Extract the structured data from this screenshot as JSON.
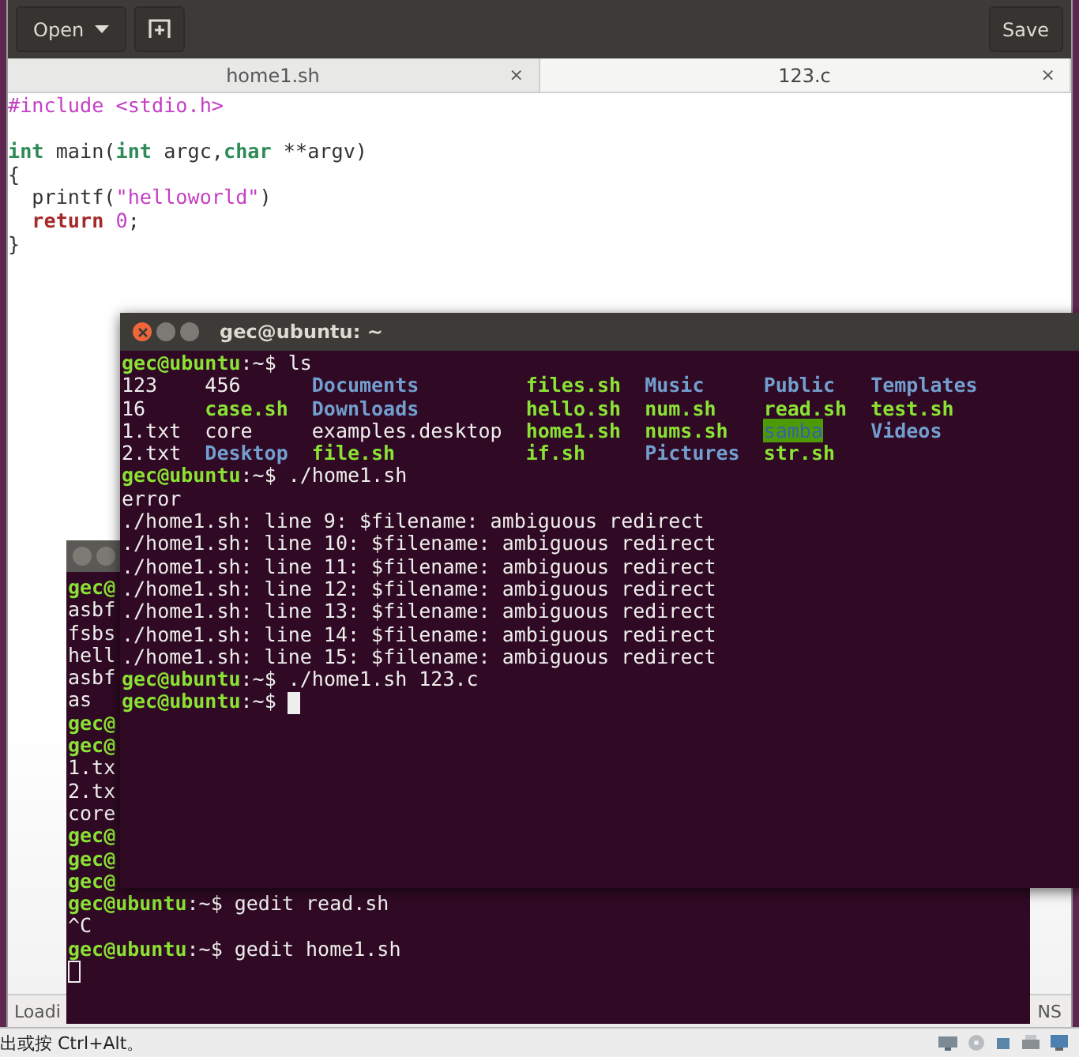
{
  "editor": {
    "toolbar": {
      "open_button": "Open",
      "save_button": "Save"
    },
    "tabs": [
      {
        "label": "home1.sh",
        "close": "×",
        "selected": false
      },
      {
        "label": "123.c",
        "close": "×",
        "selected": true
      }
    ],
    "code": [
      {
        "kind": "code",
        "segments": [
          {
            "kind": "preproc",
            "text": "#include <stdio.h>"
          }
        ]
      },
      {
        "kind": "blank"
      },
      {
        "kind": "code",
        "segments": [
          {
            "kind": "type",
            "text": "int"
          },
          {
            "kind": "plain",
            "text": " main("
          },
          {
            "kind": "type",
            "text": "int"
          },
          {
            "kind": "plain",
            "text": " argc,"
          },
          {
            "kind": "type",
            "text": "char"
          },
          {
            "kind": "plain",
            "text": " **argv)"
          }
        ]
      },
      {
        "kind": "code",
        "segments": [
          {
            "kind": "plain",
            "text": "{"
          }
        ]
      },
      {
        "kind": "code",
        "segments": [
          {
            "kind": "plain",
            "text": "  printf("
          },
          {
            "kind": "string",
            "text": "\"helloworld\""
          },
          {
            "kind": "plain",
            "text": ")"
          }
        ]
      },
      {
        "kind": "code",
        "segments": [
          {
            "kind": "keyword",
            "text": "  return"
          },
          {
            "kind": "number",
            "text": " 0"
          },
          {
            "kind": "plain",
            "text": ";"
          }
        ]
      },
      {
        "kind": "code",
        "segments": [
          {
            "kind": "plain",
            "text": "}"
          }
        ]
      }
    ],
    "status_bar": {
      "left": "Loadi",
      "right": "NS"
    }
  },
  "back_terminal": {
    "active": false,
    "lines": [
      {
        "kind": "text",
        "segments": [
          {
            "kind": "prompt",
            "text": "gec@"
          }
        ]
      },
      {
        "kind": "text",
        "segments": [
          {
            "kind": "plain",
            "text": "asbf"
          }
        ]
      },
      {
        "kind": "text",
        "segments": [
          {
            "kind": "plain",
            "text": "fsbs"
          }
        ]
      },
      {
        "kind": "text",
        "segments": [
          {
            "kind": "plain",
            "text": "hell"
          }
        ]
      },
      {
        "kind": "text",
        "segments": [
          {
            "kind": "plain",
            "text": "asbf"
          }
        ]
      },
      {
        "kind": "text",
        "segments": [
          {
            "kind": "plain",
            "text": "as"
          }
        ]
      },
      {
        "kind": "text",
        "segments": [
          {
            "kind": "prompt",
            "text": "gec@"
          }
        ]
      },
      {
        "kind": "text",
        "segments": [
          {
            "kind": "prompt",
            "text": "gec@"
          }
        ]
      },
      {
        "kind": "text",
        "segments": [
          {
            "kind": "plain",
            "text": "1.tx"
          }
        ]
      },
      {
        "kind": "text",
        "segments": [
          {
            "kind": "plain",
            "text": "2.tx"
          }
        ]
      },
      {
        "kind": "text",
        "segments": [
          {
            "kind": "plain",
            "text": "core"
          }
        ]
      },
      {
        "kind": "text",
        "segments": [
          {
            "kind": "prompt",
            "text": "gec@"
          }
        ]
      },
      {
        "kind": "text",
        "segments": [
          {
            "kind": "prompt",
            "text": "gec@"
          }
        ]
      },
      {
        "kind": "text",
        "segments": [
          {
            "kind": "prompt",
            "text": "gec@"
          }
        ]
      },
      {
        "kind": "text",
        "segments": [
          {
            "kind": "prompt",
            "text": "gec@ubuntu"
          },
          {
            "kind": "plain",
            "text": ":~$ gedit read.sh"
          }
        ]
      },
      {
        "kind": "text",
        "segments": [
          {
            "kind": "plain",
            "text": "^C"
          }
        ]
      },
      {
        "kind": "text",
        "segments": [
          {
            "kind": "prompt",
            "text": "gec@ubuntu"
          },
          {
            "kind": "plain",
            "text": ":~$ gedit home1.sh"
          }
        ]
      },
      {
        "kind": "blank"
      }
    ]
  },
  "front_terminal": {
    "title": "gec@ubuntu: ~",
    "active": true,
    "lines": [
      {
        "kind": "text",
        "segments": [
          {
            "kind": "prompt",
            "text": "gec@ubuntu"
          },
          {
            "kind": "plain",
            "text": ":~$ ls"
          }
        ]
      },
      {
        "kind": "listing",
        "cells": [
          {
            "kind": "plain",
            "text": "123"
          },
          {
            "kind": "plain",
            "text": "456"
          },
          {
            "kind": "dir",
            "text": "Documents"
          },
          {
            "kind": "exec",
            "text": "files.sh"
          },
          {
            "kind": "dir",
            "text": "Music"
          },
          {
            "kind": "dir",
            "text": "Public"
          },
          {
            "kind": "dir",
            "text": "Templates"
          }
        ]
      },
      {
        "kind": "listing",
        "cells": [
          {
            "kind": "plain",
            "text": "16"
          },
          {
            "kind": "exec",
            "text": "case.sh"
          },
          {
            "kind": "dir",
            "text": "Downloads"
          },
          {
            "kind": "exec",
            "text": "hello.sh"
          },
          {
            "kind": "exec",
            "text": "num.sh"
          },
          {
            "kind": "exec",
            "text": "read.sh"
          },
          {
            "kind": "exec",
            "text": "test.sh"
          }
        ]
      },
      {
        "kind": "listing",
        "cells": [
          {
            "kind": "plain",
            "text": "1.txt"
          },
          {
            "kind": "plain",
            "text": "core"
          },
          {
            "kind": "plain",
            "text": "examples.desktop"
          },
          {
            "kind": "exec",
            "text": "home1.sh"
          },
          {
            "kind": "exec",
            "text": "nums.sh"
          },
          {
            "kind": "highlight",
            "text": "samba"
          },
          {
            "kind": "dir",
            "text": "Videos"
          }
        ]
      },
      {
        "kind": "listing",
        "cells": [
          {
            "kind": "plain",
            "text": "2.txt"
          },
          {
            "kind": "dir",
            "text": "Desktop"
          },
          {
            "kind": "exec",
            "text": "file.sh"
          },
          {
            "kind": "exec",
            "text": "if.sh"
          },
          {
            "kind": "dir",
            "text": "Pictures"
          },
          {
            "kind": "exec",
            "text": "str.sh"
          }
        ]
      },
      {
        "kind": "text",
        "segments": [
          {
            "kind": "prompt",
            "text": "gec@ubuntu"
          },
          {
            "kind": "plain",
            "text": ":~$ ./home1.sh"
          }
        ]
      },
      {
        "kind": "text",
        "segments": [
          {
            "kind": "plain",
            "text": "error"
          }
        ]
      },
      {
        "kind": "text",
        "segments": [
          {
            "kind": "plain",
            "text": "./home1.sh: line 9: $filename: ambiguous redirect"
          }
        ]
      },
      {
        "kind": "text",
        "segments": [
          {
            "kind": "plain",
            "text": "./home1.sh: line 10: $filename: ambiguous redirect"
          }
        ]
      },
      {
        "kind": "text",
        "segments": [
          {
            "kind": "plain",
            "text": "./home1.sh: line 11: $filename: ambiguous redirect"
          }
        ]
      },
      {
        "kind": "text",
        "segments": [
          {
            "kind": "plain",
            "text": "./home1.sh: line 12: $filename: ambiguous redirect"
          }
        ]
      },
      {
        "kind": "text",
        "segments": [
          {
            "kind": "plain",
            "text": "./home1.sh: line 13: $filename: ambiguous redirect"
          }
        ]
      },
      {
        "kind": "text",
        "segments": [
          {
            "kind": "plain",
            "text": "./home1.sh: line 14: $filename: ambiguous redirect"
          }
        ]
      },
      {
        "kind": "text",
        "segments": [
          {
            "kind": "plain",
            "text": "./home1.sh: line 15: $filename: ambiguous redirect"
          }
        ]
      },
      {
        "kind": "text",
        "segments": [
          {
            "kind": "prompt",
            "text": "gec@ubuntu"
          },
          {
            "kind": "plain",
            "text": ":~$ ./home1.sh 123.c"
          }
        ]
      },
      {
        "kind": "text",
        "segments": [
          {
            "kind": "prompt",
            "text": "gec@ubuntu"
          },
          {
            "kind": "plain",
            "text": ":~$ "
          }
        ]
      }
    ]
  },
  "host_bar": {
    "hint": "出或按 Ctrl+Alt。"
  }
}
